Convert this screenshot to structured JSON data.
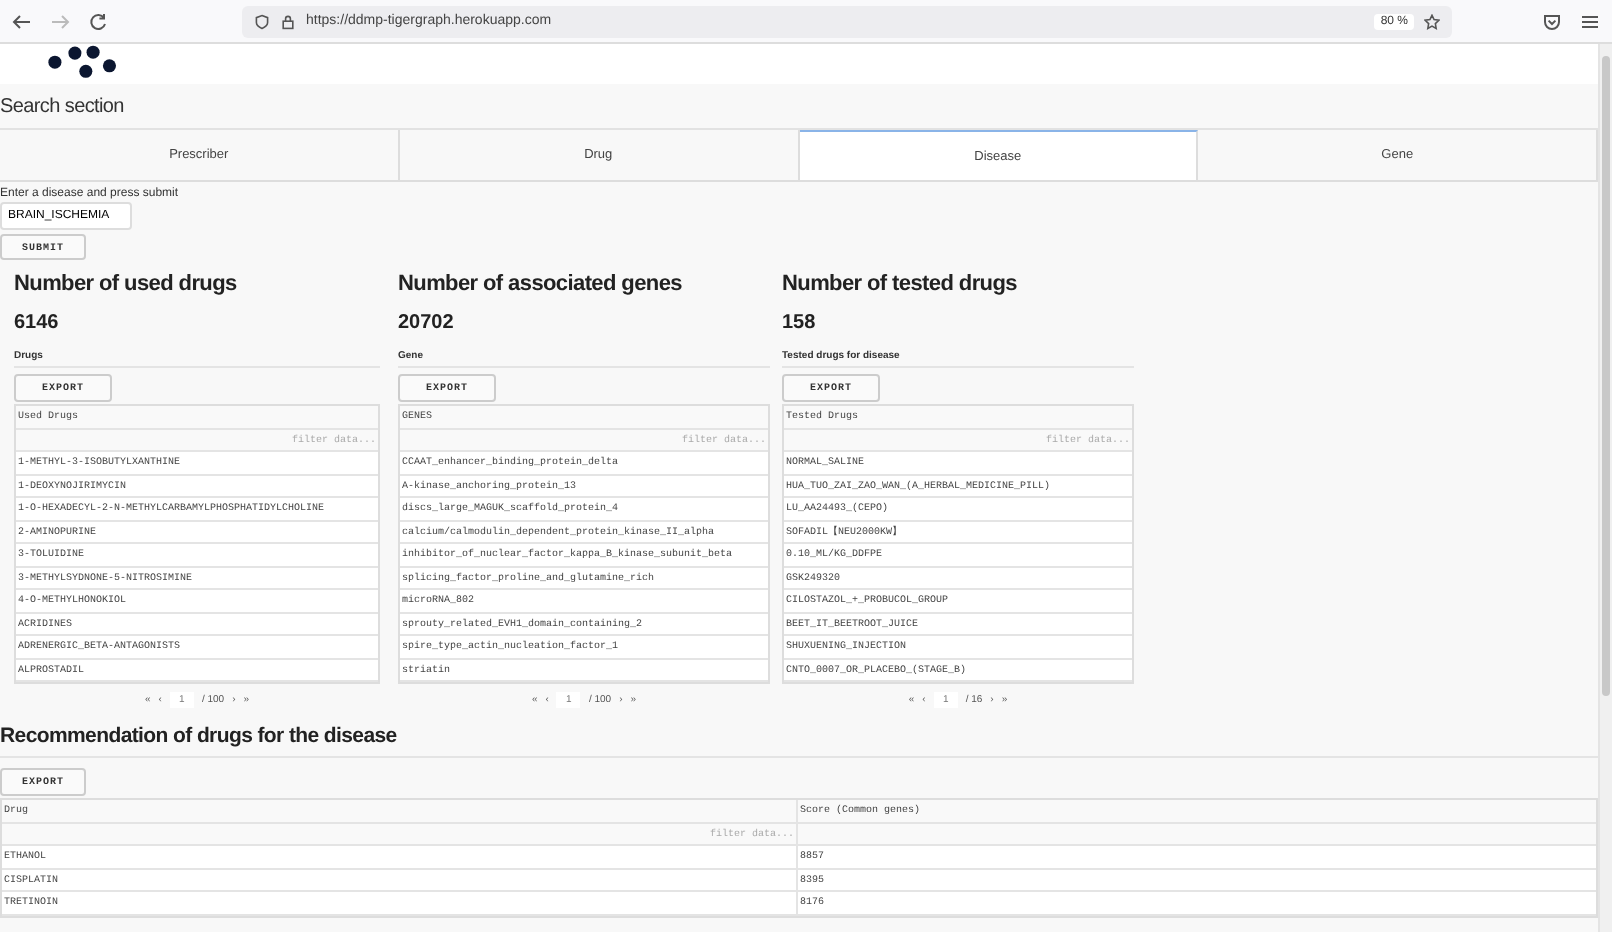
{
  "browser": {
    "url": "https://ddmp-tigergraph.herokuapp.com",
    "zoom": "80 %"
  },
  "search_section": {
    "title": "Search section"
  },
  "tabs": [
    {
      "label": "Prescriber",
      "selected": false
    },
    {
      "label": "Drug",
      "selected": false
    },
    {
      "label": "Disease",
      "selected": true
    },
    {
      "label": "Gene",
      "selected": false
    }
  ],
  "form": {
    "label": "Enter a disease and press submit",
    "value": "BRAIN_ISCHEMIA",
    "submit": "SUBMIT"
  },
  "panels": [
    {
      "heading": "Number of used drugs",
      "count": "6146",
      "table_title": "Drugs",
      "export": "EXPORT",
      "column": "Used Drugs",
      "filter_placeholder": "filter data...",
      "rows": [
        "1-METHYL-3-ISOBUTYLXANTHINE",
        "1-DEOXYNOJIRIMYCIN",
        "1-O-HEXADECYL-2-N-METHYLCARBAMYLPHOSPHATIDYLCHOLINE",
        "2-AMINOPURINE",
        "3-TOLUIDINE",
        "3-METHYLSYDNONE-5-NITROSIMINE",
        "4-O-METHYLHONOKIOL",
        "ACRIDINES",
        "ADRENERGIC_BETA-ANTAGONISTS",
        "ALPROSTADIL"
      ],
      "pager": {
        "first": "«",
        "prev": "‹",
        "page": "1",
        "total": "/ 100",
        "next": "›",
        "last": "»"
      }
    },
    {
      "heading": "Number of associated genes",
      "count": "20702",
      "table_title": "Gene",
      "export": "EXPORT",
      "column": "GENES",
      "filter_placeholder": "filter data...",
      "rows": [
        "CCAAT_enhancer_binding_protein_delta",
        "A-kinase_anchoring_protein_13",
        "discs_large_MAGUK_scaffold_protein_4",
        "calcium/calmodulin_dependent_protein_kinase_II_alpha",
        "inhibitor_of_nuclear_factor_kappa_B_kinase_subunit_beta",
        "splicing_factor_proline_and_glutamine_rich",
        "microRNA_802",
        "sprouty_related_EVH1_domain_containing_2",
        "spire_type_actin_nucleation_factor_1",
        "striatin"
      ],
      "pager": {
        "first": "«",
        "prev": "‹",
        "page": "1",
        "total": "/ 100",
        "next": "›",
        "last": "»"
      }
    },
    {
      "heading": "Number of tested drugs",
      "count": "158",
      "table_title": "Tested drugs for disease",
      "export": "EXPORT",
      "column": "Tested Drugs",
      "filter_placeholder": "filter data...",
      "rows": [
        "NORMAL_SALINE",
        "HUA_TUO_ZAI_ZAO_WAN_(A_HERBAL_MEDICINE_PILL)",
        "LU_AA24493_(CEPO)",
        "SOFADIL【NEU2000KW】",
        "0.10_ML/KG_DDFPE",
        "GSK249320",
        "CILOSTAZOL_+_PROBUCOL_GROUP",
        "BEET_IT_BEETROOT_JUICE",
        "SHUXUENING_INJECTION",
        "CNTO_0007_OR_PLACEBO_(STAGE_B)"
      ],
      "pager": {
        "first": "«",
        "prev": "‹",
        "page": "1",
        "total": "/ 16",
        "next": "›",
        "last": "»"
      }
    }
  ],
  "recommendation": {
    "heading": "Recommendation of drugs for the disease",
    "export": "EXPORT",
    "columns": [
      "Drug",
      "Score (Common genes)"
    ],
    "filter_placeholder": "filter data...",
    "rows": [
      [
        "ETHANOL",
        "8857"
      ],
      [
        "CISPLATIN",
        "8395"
      ],
      [
        "TRETINOIN",
        "8176"
      ]
    ]
  }
}
